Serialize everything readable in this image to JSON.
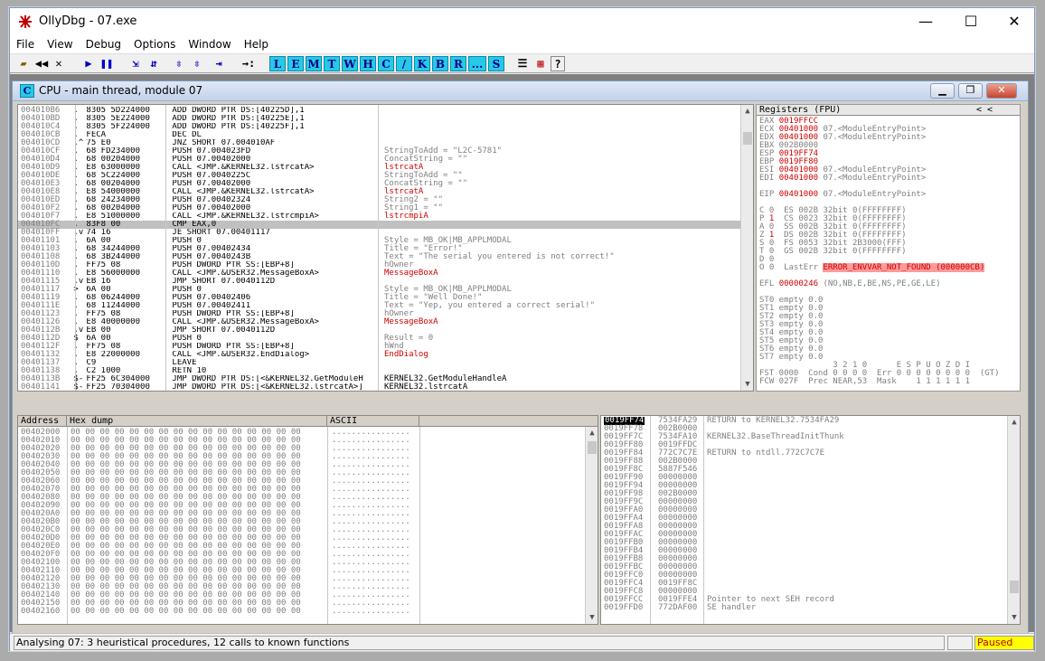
{
  "window": {
    "title": "OllyDbg - 07.exe",
    "minimize": "—",
    "maximize": "☐",
    "close": "✕"
  },
  "menu": [
    "File",
    "View",
    "Debug",
    "Options",
    "Window",
    "Help"
  ],
  "toolbar": {
    "nav": [
      "▰",
      "◀◀",
      "✕",
      "▶",
      "❚❚",
      "⇲",
      "⇵",
      "⇳",
      "⇳",
      "⇥",
      "→:"
    ],
    "letters": [
      "L",
      "E",
      "M",
      "T",
      "W",
      "H",
      "C",
      "/",
      "K",
      "B",
      "R",
      "...",
      "S"
    ],
    "extras": [
      "☰",
      "▦",
      "?"
    ]
  },
  "cpu": {
    "icon": "C",
    "title": "CPU - main thread, module 07"
  },
  "disasm": [
    {
      "a": "004010B6",
      "m": " .",
      "h": " 8305 5D224000",
      "i": " ADD DWORD PTR DS:[40225D],1",
      "c": "",
      "cc": ""
    },
    {
      "a": "004010BD",
      "m": " .",
      "h": " 8305 5E224000",
      "i": " ADD DWORD PTR DS:[40225E],1",
      "c": "",
      "cc": ""
    },
    {
      "a": "004010C4",
      "m": " .",
      "h": " 8305 5F224000",
      "i": " ADD DWORD PTR DS:[40225F],1",
      "c": "",
      "cc": ""
    },
    {
      "a": "004010CB",
      "m": " .",
      "h": " FECA",
      "i": " DEC DL",
      "c": "",
      "cc": ""
    },
    {
      "a": "004010CD",
      "m": " .^",
      "h": " 75 E0",
      "i": " JNZ SHORT 07.004010AF",
      "c": "",
      "cc": ""
    },
    {
      "a": "004010CF",
      "m": " .",
      "h": " 68 FD234000",
      "i": " PUSH 07.004023FD",
      "c": "StringToAdd = \"L2C-5781\"",
      "cc": "grey"
    },
    {
      "a": "004010D4",
      "m": " .",
      "h": " 68 00204000",
      "i": " PUSH 07.00402000",
      "c": "ConcatString = \"\"",
      "cc": "grey"
    },
    {
      "a": "004010D9",
      "m": " .",
      "h": " E8 63000000",
      "i": " CALL <JMP.&KERNEL32.lstrcatA>",
      "c": "lstrcatA",
      "cc": "red"
    },
    {
      "a": "004010DE",
      "m": " .",
      "h": " 68 5C224000",
      "i": " PUSH 07.0040225C",
      "c": "StringToAdd = \"\"",
      "cc": "grey"
    },
    {
      "a": "004010E3",
      "m": " .",
      "h": " 68 00204000",
      "i": " PUSH 07.00402000",
      "c": "ConcatString = \"\"",
      "cc": "grey"
    },
    {
      "a": "004010E8",
      "m": " .",
      "h": " E8 54000000",
      "i": " CALL <JMP.&KERNEL32.lstrcatA>",
      "c": "lstrcatA",
      "cc": "red"
    },
    {
      "a": "004010ED",
      "m": " .",
      "h": " 68 24234000",
      "i": " PUSH 07.00402324",
      "c": "String2 = \"\"",
      "cc": "grey"
    },
    {
      "a": "004010F2",
      "m": " .",
      "h": " 68 00204000",
      "i": " PUSH 07.00402000",
      "c": "String1 = \"\"",
      "cc": "grey"
    },
    {
      "a": "004010F7",
      "m": " .",
      "h": " E8 51000000",
      "i": " CALL <JMP.&KERNEL32.lstrcmpiA>",
      "c": "lstrcmpiA",
      "cc": "red"
    },
    {
      "a": "004010FC",
      "m": " .",
      "h": " 83F8 00",
      "i": " CMP EAX,0",
      "c": "",
      "cc": "",
      "sel": true
    },
    {
      "a": "004010FF",
      "m": " .v",
      "h": " 74 16",
      "i": " JE SHORT 07.00401117",
      "c": "",
      "cc": ""
    },
    {
      "a": "00401101",
      "m": " .",
      "h": " 6A 00",
      "i": " PUSH 0",
      "c": "Style = MB_OK|MB_APPLMODAL",
      "cc": "grey"
    },
    {
      "a": "00401103",
      "m": " .",
      "h": " 68 34244000",
      "i": " PUSH 07.00402434",
      "c": "Title = \"Error!\"",
      "cc": "grey"
    },
    {
      "a": "00401108",
      "m": " .",
      "h": " 68 3B244000",
      "i": " PUSH 07.0040243B",
      "c": "Text = \"The serial you entered is not correct!\"",
      "cc": "grey"
    },
    {
      "a": "0040110D",
      "m": " .",
      "h": " FF75 08",
      "i": " PUSH DWORD PTR SS:[EBP+8]",
      "c": "hOwner",
      "cc": "grey"
    },
    {
      "a": "00401110",
      "m": " .",
      "h": " E8 56000000",
      "i": " CALL <JMP.&USER32.MessageBoxA>",
      "c": "MessageBoxA",
      "cc": "red"
    },
    {
      "a": "00401115",
      "m": " .v",
      "h": " EB 16",
      "i": " JMP SHORT 07.0040112D",
      "c": "",
      "cc": ""
    },
    {
      "a": "00401117",
      "m": " >",
      "h": " 6A 00",
      "i": " PUSH 0",
      "c": "Style = MB_OK|MB_APPLMODAL",
      "cc": "grey"
    },
    {
      "a": "00401119",
      "m": " .",
      "h": " 68 06244000",
      "i": " PUSH 07.00402406",
      "c": "Title = \"Well Done!\"",
      "cc": "grey"
    },
    {
      "a": "0040111E",
      "m": " .",
      "h": " 68 11244000",
      "i": " PUSH 07.00402411",
      "c": "Text = \"Yep, you entered a correct serial!\"",
      "cc": "grey"
    },
    {
      "a": "00401123",
      "m": " .",
      "h": " FF75 08",
      "i": " PUSH DWORD PTR SS:[EBP+8]",
      "c": "hOwner",
      "cc": "grey"
    },
    {
      "a": "00401126",
      "m": " .",
      "h": " E8 40000000",
      "i": " CALL <JMP.&USER32.MessageBoxA>",
      "c": "MessageBoxA",
      "cc": "red"
    },
    {
      "a": "0040112B",
      "m": " .v",
      "h": " EB 00",
      "i": " JMP SHORT 07.0040112D",
      "c": "",
      "cc": ""
    },
    {
      "a": "0040112D",
      "m": " $",
      "h": " 6A 00",
      "i": " PUSH 0",
      "c": "Result = 0",
      "cc": "grey"
    },
    {
      "a": "0040112F",
      "m": " .",
      "h": " FF75 08",
      "i": " PUSH DWORD PTR SS:[EBP+8]",
      "c": "hWnd",
      "cc": "grey"
    },
    {
      "a": "00401132",
      "m": " .",
      "h": " E8 22000000",
      "i": " CALL <JMP.&USER32.EndDialog>",
      "c": "EndDialog",
      "cc": "red"
    },
    {
      "a": "00401137",
      "m": " .",
      "h": " C9",
      "i": " LEAVE",
      "c": "",
      "cc": ""
    },
    {
      "a": "00401138",
      "m": " .",
      "h": " C2 1000",
      "i": " RETN 10",
      "c": "",
      "cc": ""
    },
    {
      "a": "0040113B",
      "m": " $-",
      "h": " FF25 6C304000",
      "i": " JMP DWORD PTR DS:[<&KERNEL32.GetModuleH",
      "c": "KERNEL32.GetModuleHandleA",
      "cc": "blk"
    },
    {
      "a": "00401141",
      "m": " $-",
      "h": " FF25 70304000",
      "i": " JMP DWORD PTR DS:[<&KERNEL32.lstrcatA>]",
      "c": "KERNEL32.lstrcatA",
      "cc": "blk"
    }
  ],
  "registers": {
    "header": "Registers (FPU)",
    "header_arrows": "<   <",
    "rows": [
      [
        {
          "t": "EAX ",
          "c": "grey"
        },
        {
          "t": "0019FFCC",
          "c": "red"
        }
      ],
      [
        {
          "t": "ECX ",
          "c": "grey"
        },
        {
          "t": "00401000",
          "c": "red"
        },
        {
          "t": " 07.<ModuleEntryPoint>",
          "c": "grey"
        }
      ],
      [
        {
          "t": "EDX ",
          "c": "grey"
        },
        {
          "t": "00401000",
          "c": "red"
        },
        {
          "t": " 07.<ModuleEntryPoint>",
          "c": "grey"
        }
      ],
      [
        {
          "t": "EBX 002B0000",
          "c": "grey"
        }
      ],
      [
        {
          "t": "ESP ",
          "c": "grey"
        },
        {
          "t": "0019FF74",
          "c": "red"
        }
      ],
      [
        {
          "t": "EBP ",
          "c": "grey"
        },
        {
          "t": "0019FF80",
          "c": "red"
        }
      ],
      [
        {
          "t": "ESI ",
          "c": "grey"
        },
        {
          "t": "00401000",
          "c": "red"
        },
        {
          "t": " 07.<ModuleEntryPoint>",
          "c": "grey"
        }
      ],
      [
        {
          "t": "EDI ",
          "c": "grey"
        },
        {
          "t": "00401000",
          "c": "red"
        },
        {
          "t": " 07.<ModuleEntryPoint>",
          "c": "grey"
        }
      ],
      [
        {
          "t": "",
          "c": "grey"
        }
      ],
      [
        {
          "t": "EIP ",
          "c": "grey"
        },
        {
          "t": "00401000",
          "c": "red"
        },
        {
          "t": " 07.<ModuleEntryPoint>",
          "c": "grey"
        }
      ],
      [
        {
          "t": "",
          "c": "grey"
        }
      ],
      [
        {
          "t": "C 0  ES 002B 32bit 0(FFFFFFFF)",
          "c": "grey"
        }
      ],
      [
        {
          "t": "P ",
          "c": "grey"
        },
        {
          "t": "1",
          "c": "red"
        },
        {
          "t": "  CS 0023 32bit 0(FFFFFFFF)",
          "c": "grey"
        }
      ],
      [
        {
          "t": "A 0  SS 002B 32bit 0(FFFFFFFF)",
          "c": "grey"
        }
      ],
      [
        {
          "t": "Z ",
          "c": "grey"
        },
        {
          "t": "1",
          "c": "red"
        },
        {
          "t": "  DS 002B 32bit 0(FFFFFFFF)",
          "c": "grey"
        }
      ],
      [
        {
          "t": "S 0  FS 0053 32bit 2B3000(FFF)",
          "c": "grey"
        }
      ],
      [
        {
          "t": "T 0  GS 002B 32bit 0(FFFFFFFF)",
          "c": "grey"
        }
      ],
      [
        {
          "t": "D 0",
          "c": "grey"
        }
      ],
      [
        {
          "t": "O 0  LastErr ",
          "c": "grey"
        },
        {
          "t": "ERROR_ENVVAR_NOT_FOUND (000000CB)",
          "c": "errhl"
        }
      ],
      [
        {
          "t": "",
          "c": "grey"
        }
      ],
      [
        {
          "t": "EFL ",
          "c": "grey"
        },
        {
          "t": "00000246",
          "c": "red"
        },
        {
          "t": " (NO,NB,E,BE,NS,PE,GE,LE)",
          "c": "grey"
        }
      ],
      [
        {
          "t": "",
          "c": "grey"
        }
      ],
      [
        {
          "t": "ST0 empty 0.0",
          "c": "grey"
        }
      ],
      [
        {
          "t": "ST1 empty 0.0",
          "c": "grey"
        }
      ],
      [
        {
          "t": "ST2 empty 0.0",
          "c": "grey"
        }
      ],
      [
        {
          "t": "ST3 empty 0.0",
          "c": "grey"
        }
      ],
      [
        {
          "t": "ST4 empty 0.0",
          "c": "grey"
        }
      ],
      [
        {
          "t": "ST5 empty 0.0",
          "c": "grey"
        }
      ],
      [
        {
          "t": "ST6 empty 0.0",
          "c": "grey"
        }
      ],
      [
        {
          "t": "ST7 empty 0.0",
          "c": "grey"
        }
      ],
      [
        {
          "t": "               3 2 1 0      E S P U O Z D I",
          "c": "grey"
        }
      ],
      [
        {
          "t": "FST 0000  Cond 0 0 0 0  Err 0 0 0 0 0 0 0 0  (GT)",
          "c": "grey"
        }
      ],
      [
        {
          "t": "FCW 027F  Prec NEAR,53  Mask    1 1 1 1 1 1",
          "c": "grey"
        }
      ]
    ]
  },
  "dump": {
    "headers": [
      "Address",
      "Hex dump",
      "ASCII"
    ],
    "addresses": [
      "00402000",
      "00402010",
      "00402020",
      "00402030",
      "00402040",
      "00402050",
      "00402060",
      "00402070",
      "00402080",
      "00402090",
      "004020A0",
      "004020B0",
      "004020C0",
      "004020D0",
      "004020E0",
      "004020F0",
      "00402100",
      "00402110",
      "00402120",
      "00402130",
      "00402140",
      "00402150",
      "00402160"
    ],
    "hex": "00 00 00 00 00 00 00 00 00 00 00 00 00 00 00 00",
    "ascii": "................"
  },
  "stack": [
    {
      "a": "0019FF74",
      "v": "7534FA29",
      "c": "RETURN to KERNEL32.7534FA29",
      "top": true
    },
    {
      "a": "0019FF78",
      "v": "002B0000",
      "c": ""
    },
    {
      "a": "0019FF7C",
      "v": "7534FA10",
      "c": "KERNEL32.BaseThreadInitThunk"
    },
    {
      "a": "0019FF80",
      "v": "0019FFDC",
      "c": ""
    },
    {
      "a": "0019FF84",
      "v": "772C7C7E",
      "c": "RETURN to ntdll.772C7C7E"
    },
    {
      "a": "0019FF88",
      "v": "002B0000",
      "c": ""
    },
    {
      "a": "0019FF8C",
      "v": "5887F546",
      "c": ""
    },
    {
      "a": "0019FF90",
      "v": "00000000",
      "c": ""
    },
    {
      "a": "0019FF94",
      "v": "00000000",
      "c": ""
    },
    {
      "a": "0019FF98",
      "v": "002B0000",
      "c": ""
    },
    {
      "a": "0019FF9C",
      "v": "00000000",
      "c": ""
    },
    {
      "a": "0019FFA0",
      "v": "00000000",
      "c": ""
    },
    {
      "a": "0019FFA4",
      "v": "00000000",
      "c": ""
    },
    {
      "a": "0019FFA8",
      "v": "00000000",
      "c": ""
    },
    {
      "a": "0019FFAC",
      "v": "00000000",
      "c": ""
    },
    {
      "a": "0019FFB0",
      "v": "00000000",
      "c": ""
    },
    {
      "a": "0019FFB4",
      "v": "00000000",
      "c": ""
    },
    {
      "a": "0019FFB8",
      "v": "00000000",
      "c": ""
    },
    {
      "a": "0019FFBC",
      "v": "00000000",
      "c": ""
    },
    {
      "a": "0019FFC0",
      "v": "00000000",
      "c": ""
    },
    {
      "a": "0019FFC4",
      "v": "0019FF8C",
      "c": ""
    },
    {
      "a": "0019FFC8",
      "v": "00000000",
      "c": ""
    },
    {
      "a": "0019FFCC",
      "v": "0019FFE4",
      "c": "Pointer to next SEH record"
    },
    {
      "a": "0019FFD0",
      "v": "772DAF00",
      "c": "SE handler"
    }
  ],
  "status": {
    "text": "Analysing 07: 3 heuristical procedures, 12 calls to known functions",
    "state": "Paused"
  },
  "colors": {
    "accent_cyan": "#28c8e8",
    "address_red": "#d00000",
    "paused_bg": "#ffff00"
  }
}
